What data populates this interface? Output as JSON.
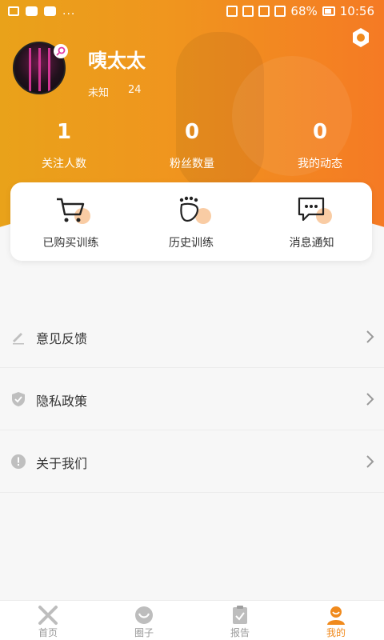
{
  "status_bar": {
    "dots": "...",
    "battery": "68%",
    "time": "10:56"
  },
  "profile": {
    "name": "咦太太",
    "gender": "未知",
    "age": "24"
  },
  "stats": [
    {
      "value": "1",
      "label": "关注人数"
    },
    {
      "value": "0",
      "label": "粉丝数量"
    },
    {
      "value": "0",
      "label": "我的动态"
    }
  ],
  "quick_actions": [
    {
      "label": "已购买训练",
      "icon": "cart-icon"
    },
    {
      "label": "历史训练",
      "icon": "footprint-icon"
    },
    {
      "label": "消息通知",
      "icon": "message-icon"
    }
  ],
  "menu": [
    {
      "label": "意见反馈",
      "icon": "edit-icon"
    },
    {
      "label": "隐私政策",
      "icon": "shield-icon"
    },
    {
      "label": "关于我们",
      "icon": "info-icon"
    }
  ],
  "tabs": [
    {
      "label": "首页",
      "icon": "home-x-icon",
      "active": false
    },
    {
      "label": "圈子",
      "icon": "circle-icon",
      "active": false
    },
    {
      "label": "报告",
      "icon": "report-icon",
      "active": false
    },
    {
      "label": "我的",
      "icon": "profile-icon",
      "active": true
    }
  ],
  "colors": {
    "accent": "#f08a1d",
    "gradient_start": "#e9a21a",
    "gradient_end": "#f57a24"
  }
}
